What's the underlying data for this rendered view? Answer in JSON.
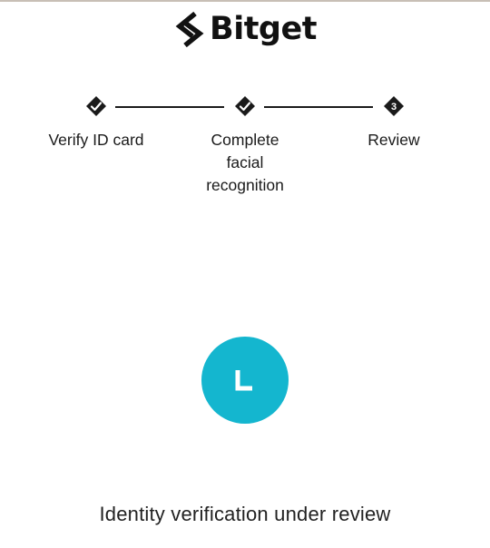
{
  "brand": {
    "name": "Bitget",
    "logo_icon": "bitget-logo-icon"
  },
  "steps": [
    {
      "label": "Verify ID card",
      "state": "completed",
      "icon": "check-icon"
    },
    {
      "label": "Complete facial recognition",
      "state": "completed",
      "icon": "check-icon"
    },
    {
      "label": "Review",
      "state": "current",
      "number": "3"
    }
  ],
  "status": {
    "icon": "clock-icon",
    "message": "Identity verification under review"
  },
  "colors": {
    "accent": "#14b6cf",
    "step": "#1a1a1a",
    "text": "#222222"
  }
}
